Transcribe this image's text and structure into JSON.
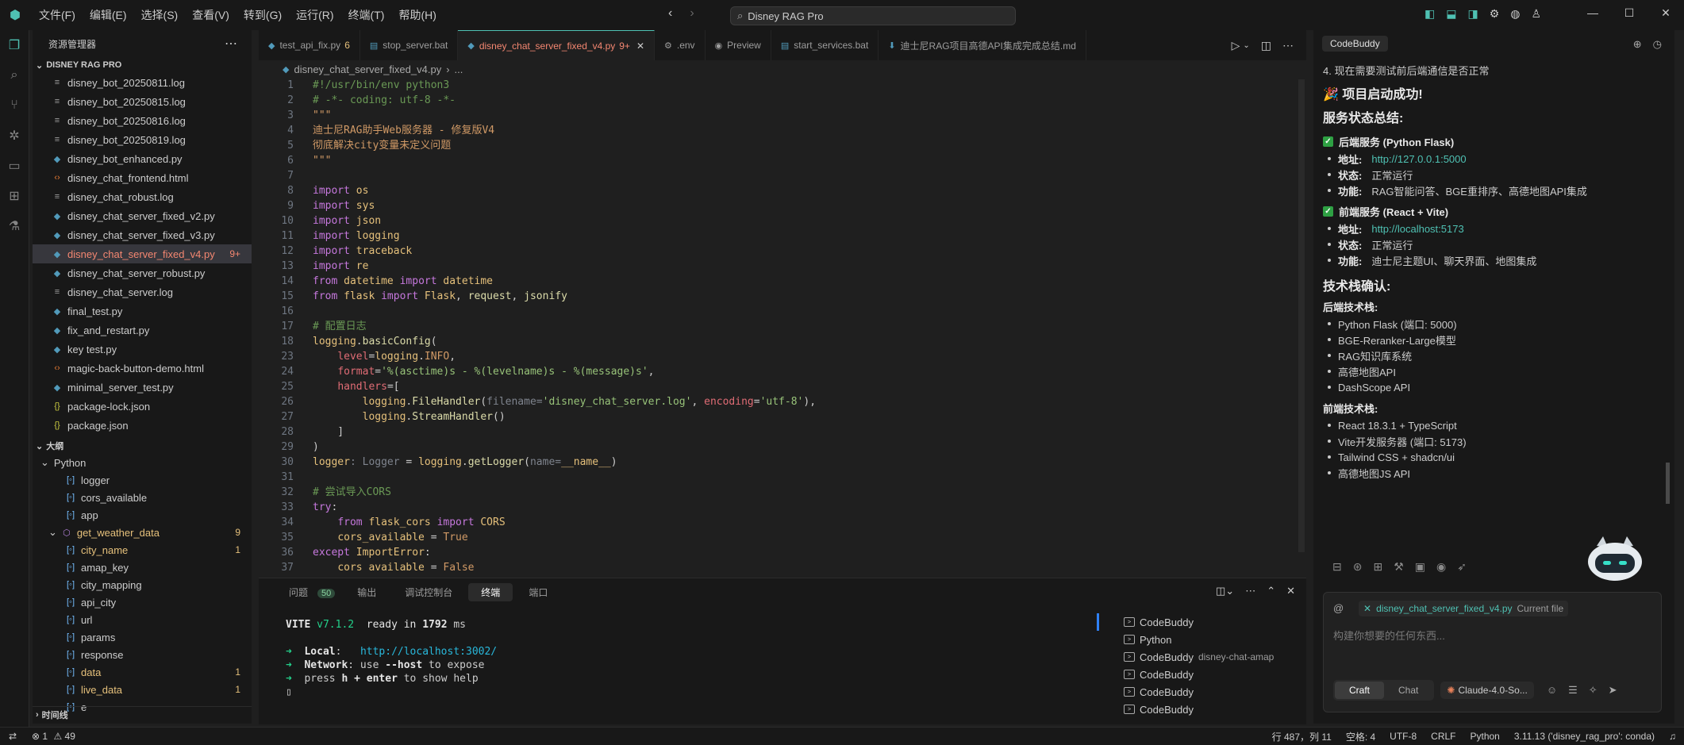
{
  "menu": [
    "文件(F)",
    "编辑(E)",
    "选择(S)",
    "查看(V)",
    "转到(G)",
    "运行(R)",
    "终端(T)",
    "帮助(H)"
  ],
  "search": {
    "value": "Disney RAG Pro"
  },
  "explorer": {
    "title": "资源管理器",
    "root": "DISNEY RAG PRO",
    "files": [
      {
        "name": "disney_bot_20250811.log",
        "icon": "log"
      },
      {
        "name": "disney_bot_20250815.log",
        "icon": "log"
      },
      {
        "name": "disney_bot_20250816.log",
        "icon": "log"
      },
      {
        "name": "disney_bot_20250819.log",
        "icon": "log"
      },
      {
        "name": "disney_bot_enhanced.py",
        "icon": "py"
      },
      {
        "name": "disney_chat_frontend.html",
        "icon": "html"
      },
      {
        "name": "disney_chat_robust.log",
        "icon": "log"
      },
      {
        "name": "disney_chat_server_fixed_v2.py",
        "icon": "py"
      },
      {
        "name": "disney_chat_server_fixed_v3.py",
        "icon": "py"
      },
      {
        "name": "disney_chat_server_fixed_v4.py",
        "icon": "py",
        "badge": "9+",
        "selected": true
      },
      {
        "name": "disney_chat_server_robust.py",
        "icon": "py"
      },
      {
        "name": "disney_chat_server.log",
        "icon": "log"
      },
      {
        "name": "final_test.py",
        "icon": "py"
      },
      {
        "name": "fix_and_restart.py",
        "icon": "py"
      },
      {
        "name": "key test.py",
        "icon": "py"
      },
      {
        "name": "magic-back-button-demo.html",
        "icon": "html"
      },
      {
        "name": "minimal_server_test.py",
        "icon": "py"
      },
      {
        "name": "package-lock.json",
        "icon": "json"
      },
      {
        "name": "package.json",
        "icon": "json"
      }
    ]
  },
  "outline": {
    "title": "大纲",
    "group": "Python",
    "items": [
      {
        "name": "logger",
        "indent": 1
      },
      {
        "name": "cors_available",
        "indent": 1
      },
      {
        "name": "app",
        "indent": 1
      },
      {
        "name": "get_weather_data",
        "indent": 0,
        "badge": "9",
        "warn": true,
        "fn": true
      },
      {
        "name": "city_name",
        "indent": 1,
        "badge": "1",
        "warn": true
      },
      {
        "name": "amap_key",
        "indent": 1
      },
      {
        "name": "city_mapping",
        "indent": 1
      },
      {
        "name": "api_city",
        "indent": 1
      },
      {
        "name": "url",
        "indent": 1
      },
      {
        "name": "params",
        "indent": 1
      },
      {
        "name": "response",
        "indent": 1
      },
      {
        "name": "data",
        "indent": 1,
        "badge": "1",
        "warn": true
      },
      {
        "name": "live_data",
        "indent": 1,
        "badge": "1",
        "warn": true
      },
      {
        "name": "e",
        "indent": 1
      }
    ]
  },
  "timeline": "时间线",
  "tabs": [
    {
      "label": "test_api_fix.py",
      "count": "6",
      "icon": "py"
    },
    {
      "label": "stop_server.bat",
      "icon": "bat"
    },
    {
      "label": "disney_chat_server_fixed_v4.py",
      "count": "9+",
      "icon": "py",
      "active": true
    },
    {
      "label": ".env",
      "icon": "gear"
    },
    {
      "label": "Preview",
      "icon": "eye"
    },
    {
      "label": "start_services.bat",
      "icon": "bat"
    },
    {
      "label": "迪士尼RAG项目高德API集成完成总结.md",
      "icon": "md"
    }
  ],
  "breadcrumb": {
    "file": "disney_chat_server_fixed_v4.py",
    "rest": "..."
  },
  "code": [
    {
      "n": "1",
      "html": "<span class=\"c\">#!/usr/bin/env python3</span>"
    },
    {
      "n": "2",
      "html": "<span class=\"c\"># -*- coding: utf-8 -*-</span>"
    },
    {
      "n": "3",
      "html": "<span class=\"n\">\"\"\"</span>"
    },
    {
      "n": "4",
      "html": "<span class=\"n\">迪士尼RAG助手Web服务器 - 修复版V4</span>"
    },
    {
      "n": "5",
      "html": "<span class=\"n\">彻底解决city变量未定义问题</span>"
    },
    {
      "n": "6",
      "html": "<span class=\"n\">\"\"\"</span>"
    },
    {
      "n": "7",
      "html": ""
    },
    {
      "n": "8",
      "html": "<span class=\"k\">import</span> <span class=\"t\">os</span>"
    },
    {
      "n": "9",
      "html": "<span class=\"k\">import</span> <span class=\"t\">sys</span>"
    },
    {
      "n": "10",
      "html": "<span class=\"k\">import</span> <span class=\"t\">json</span>"
    },
    {
      "n": "11",
      "html": "<span class=\"k\">import</span> <span class=\"t\">logging</span>"
    },
    {
      "n": "12",
      "html": "<span class=\"k\">import</span> <span class=\"t\">traceback</span>"
    },
    {
      "n": "13",
      "html": "<span class=\"k\">import</span> <span class=\"t\">re</span>"
    },
    {
      "n": "14",
      "html": "<span class=\"k\">from</span> <span class=\"t\">datetime</span> <span class=\"k\">import</span> <span class=\"t\">datetime</span>"
    },
    {
      "n": "15",
      "html": "<span class=\"k\">from</span> <span class=\"t\">flask</span> <span class=\"k\">import</span> <span class=\"t\">Flask</span>, <span class=\"f\">request</span>, <span class=\"f\">jsonify</span>"
    },
    {
      "n": "16",
      "html": ""
    },
    {
      "n": "17",
      "html": "<span class=\"c\"># 配置日志</span>"
    },
    {
      "n": "18",
      "html": "<span class=\"t\">logging</span>.<span class=\"f\">basicConfig</span>("
    },
    {
      "n": "23",
      "html": "    <span class=\"v\">level</span>=<span class=\"t\">logging</span>.<span class=\"n\">INFO</span>,"
    },
    {
      "n": "24",
      "html": "    <span class=\"v\">format</span>=<span class=\"s\">'%(asctime)s - %(levelname)s - %(message)s'</span>,"
    },
    {
      "n": "25",
      "html": "    <span class=\"v\">handlers</span>=["
    },
    {
      "n": "26",
      "html": "        <span class=\"t\">logging</span>.<span class=\"f\">FileHandler</span>(<span class=\"h\">filename=</span><span class=\"s\">'disney_chat_server.log'</span>, <span class=\"v\">encoding</span>=<span class=\"s\">'utf-8'</span>),"
    },
    {
      "n": "27",
      "html": "        <span class=\"t\">logging</span>.<span class=\"f\">StreamHandler</span>()"
    },
    {
      "n": "28",
      "html": "    ]"
    },
    {
      "n": "29",
      "html": ")"
    },
    {
      "n": "30",
      "html": "<span class=\"t\">logger</span><span class=\"h\">: Logger</span> = <span class=\"t\">logging</span>.<span class=\"f\">getLogger</span>(<span class=\"h\">name=</span><span class=\"t\">__name__</span>)"
    },
    {
      "n": "31",
      "html": ""
    },
    {
      "n": "32",
      "html": "<span class=\"c\"># 尝试导入CORS</span>"
    },
    {
      "n": "33",
      "html": "<span class=\"k\">try</span>:"
    },
    {
      "n": "34",
      "html": "    <span class=\"k\">from</span> <span class=\"t\">flask_cors</span> <span class=\"k\">import</span> <span class=\"t\">CORS</span>"
    },
    {
      "n": "35",
      "html": "    <span class=\"t\">cors_available</span> = <span class=\"n\">True</span>"
    },
    {
      "n": "36",
      "html": "<span class=\"k\">except</span> <span class=\"t\">ImportError</span>:"
    },
    {
      "n": "37",
      "html": "    <span class=\"t\">cors_available</span> = <span class=\"n\">False</span>"
    }
  ],
  "panel": {
    "tabs": [
      "问题",
      "输出",
      "调试控制台",
      "终端",
      "端口"
    ],
    "problems_count": "50",
    "active_tab": "终端",
    "terminal_lines": [
      {
        "html": "<span class=\"tg tb\">VITE</span> <span class=\"tg\">v7.1.2</span>  <span style=\"color:#e5e5e5\">ready in</span> <span class=\"tb\">1792</span> ms"
      },
      {
        "html": ""
      },
      {
        "html": "<span class=\"tg\">➜</span>  <span class=\"tb\">Local</span>:   <span class=\"tc\">http://localhost:3002/</span>"
      },
      {
        "html": "<span class=\"tg\">➜</span>  <span class=\"tb\">Network</span>: use <span class=\"tb\">--host</span> to expose"
      },
      {
        "html": "<span class=\"tg\">➜</span>  press <span class=\"tb\">h + enter</span> to show help"
      },
      {
        "html": "▯"
      }
    ],
    "terminals": [
      {
        "name": "CodeBuddy",
        "sub": ""
      },
      {
        "name": "Python",
        "sub": ""
      },
      {
        "name": "CodeBuddy",
        "sub": "disney-chat-amap"
      },
      {
        "name": "CodeBuddy",
        "sub": ""
      },
      {
        "name": "CodeBuddy",
        "sub": ""
      },
      {
        "name": "CodeBuddy",
        "sub": ""
      }
    ]
  },
  "codebuddy": {
    "tab": "CodeBuddy",
    "intro": "4. 现在需要测试前后端通信是否正常",
    "success": "🎉 项目启动成功!",
    "status_title": "服务状态总结:",
    "backend": {
      "title": "后端服务 (Python Flask)",
      "rows": [
        {
          "label": "地址:",
          "value": "http://127.0.0.1:5000",
          "link": true
        },
        {
          "label": "状态:",
          "value": "正常运行"
        },
        {
          "label": "功能:",
          "value": "RAG智能问答、BGE重排序、高德地图API集成"
        }
      ]
    },
    "frontend": {
      "title": "前端服务 (React + Vite)",
      "rows": [
        {
          "label": "地址:",
          "value": "http://localhost:5173",
          "link": true
        },
        {
          "label": "状态:",
          "value": "正常运行"
        },
        {
          "label": "功能:",
          "value": "迪士尼主题UI、聊天界面、地图集成"
        }
      ]
    },
    "stack_title": "技术栈确认:",
    "backend_stack_title": "后端技术栈:",
    "backend_stack": [
      "Python Flask (端口: 5000)",
      "BGE-Reranker-Large模型",
      "RAG知识库系统",
      "高德地图API",
      "DashScope API"
    ],
    "frontend_stack_title": "前端技术栈:",
    "frontend_stack": [
      "React 18.3.1 + TypeScript",
      "Vite开发服务器 (端口: 5173)",
      "Tailwind CSS + shadcn/ui",
      "高德地图JS API"
    ],
    "context_file": "disney_chat_server_fixed_v4.py",
    "context_label": "Current file",
    "input_placeholder": "构建你想要的任何东西...",
    "modes": [
      "Craft",
      "Chat"
    ],
    "active_mode": "Craft",
    "model": "Claude-4.0-So..."
  },
  "status": {
    "errors": "1",
    "warnings": "49",
    "position": "行 487，列 11",
    "spaces": "空格: 4",
    "encoding": "UTF-8",
    "eol": "CRLF",
    "language": "Python",
    "interpreter": "3.11.13 ('disney_rag_pro': conda)"
  }
}
